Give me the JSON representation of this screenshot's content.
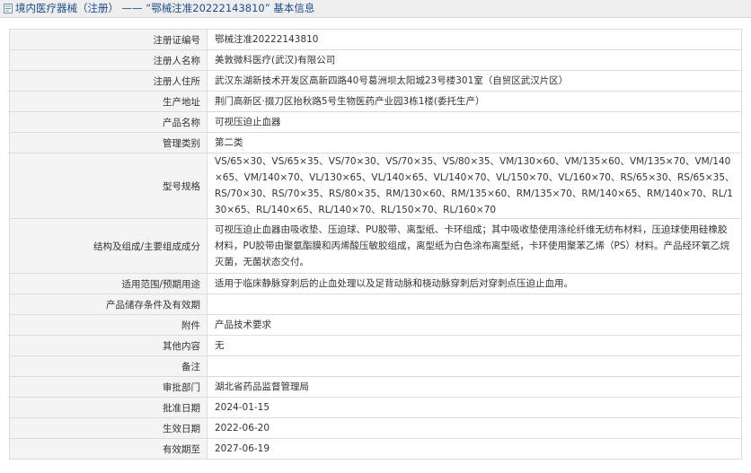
{
  "header": {
    "title": "境内医疗器械（注册） —— “鄂械注准20222143810” 基本信息"
  },
  "rows": [
    {
      "label": "注册证编号",
      "value": "鄂械注准20222143810"
    },
    {
      "label": "注册人名称",
      "value": "美敦微科医疗(武汉)有限公司"
    },
    {
      "label": "注册人住所",
      "value": "武汉东湖新技术开发区高新四路40号葛洲坝太阳城23号楼301室（自贸区武汉片区）"
    },
    {
      "label": "生产地址",
      "value": "荆门高新区·掇刀区抬秋路5号生物医药产业园3栋1楼(委托生产）"
    },
    {
      "label": "产品名称",
      "value": "可视压迫止血器"
    },
    {
      "label": "管理类别",
      "value": "第二类"
    },
    {
      "label": "型号规格",
      "value": "VS/65×30、VS/65×35、VS/70×30、VS/70×35、VS/80×35、VM/130×60、VM/135×60、VM/135×70、VM/140×65、VM/140×70、VL/130×65、VL/140×65、VL/140×70、VL/150×70、VL/160×70、RS/65×30、RS/65×35、RS/70×30、RS/70×35、RS/80×35、RM/130×60、RM/135×60、RM/135×70、RM/140×65、RM/140×70、RL/130×65、RL/140×65、RL/140×70、RL/150×70、RL/160×70"
    },
    {
      "label": "结构及组成/主要组成成分",
      "value": "可视压迫止血器由吸收垫、压迫球、PU胶带、离型纸、卡环组成；其中吸收垫使用涤纶纤维无纺布材料，压迫球使用硅橡胶材料，PU胶带由聚氨酯膜和丙烯酸压敏胶组成，离型纸为白色涂布离型纸，卡环使用聚苯乙烯（PS）材料。产品经环氧乙烷灭菌，无菌状态交付。"
    },
    {
      "label": "适用范围/预期用途",
      "value": "适用于临床静脉穿刺后的止血处理以及足背动脉和桡动脉穿刺后对穿刺点压迫止血用。"
    },
    {
      "label": "产品储存条件及有效期",
      "value": ""
    },
    {
      "label": "附件",
      "value": "产品技术要求"
    },
    {
      "label": "其他内容",
      "value": "无"
    },
    {
      "label": "备注",
      "value": ""
    },
    {
      "label": "审批部门",
      "value": "湖北省药品监督管理局"
    },
    {
      "label": "批准日期",
      "value": "2024-01-15"
    },
    {
      "label": "生效日期",
      "value": "2022-06-20"
    },
    {
      "label": "有效期至",
      "value": "2027-06-19"
    }
  ],
  "colors": {
    "title_text": "#1a4e95",
    "title_bar_bg": "#eeeeee",
    "label_bg": "#f4f4f4",
    "border": "#dcdcdc"
  },
  "icons": {
    "title_icon": "document-icon"
  }
}
